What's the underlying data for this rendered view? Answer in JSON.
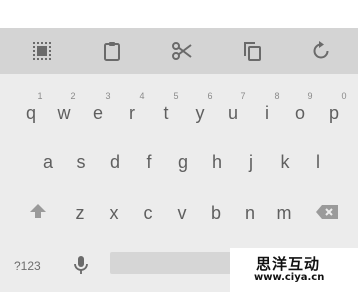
{
  "toolbar": {
    "icons": [
      "select-all-icon",
      "clipboard-icon",
      "cut-icon",
      "copy-icon",
      "undo-icon"
    ]
  },
  "keyboard": {
    "row1": [
      {
        "key": "q",
        "hint": "1"
      },
      {
        "key": "w",
        "hint": "2"
      },
      {
        "key": "e",
        "hint": "3"
      },
      {
        "key": "r",
        "hint": "4"
      },
      {
        "key": "t",
        "hint": "5"
      },
      {
        "key": "y",
        "hint": "6"
      },
      {
        "key": "u",
        "hint": "7"
      },
      {
        "key": "i",
        "hint": "8"
      },
      {
        "key": "o",
        "hint": "9"
      },
      {
        "key": "p",
        "hint": "0"
      }
    ],
    "row2": [
      "a",
      "s",
      "d",
      "f",
      "g",
      "h",
      "j",
      "k",
      "l"
    ],
    "row3": [
      "z",
      "x",
      "c",
      "v",
      "b",
      "n",
      "m"
    ],
    "numbers_key": "?123",
    "row3_icons": [
      "shift-icon",
      "backspace-icon"
    ],
    "row4_icons": [
      "mic-icon"
    ]
  },
  "watermark": {
    "title": "思洋互动",
    "url": "www.ciya.cn"
  },
  "colors": {
    "background": "#ececec",
    "toolbar": "#d4d4d4",
    "key_text": "#5f5f5f",
    "hint_text": "#8a8a8a"
  }
}
